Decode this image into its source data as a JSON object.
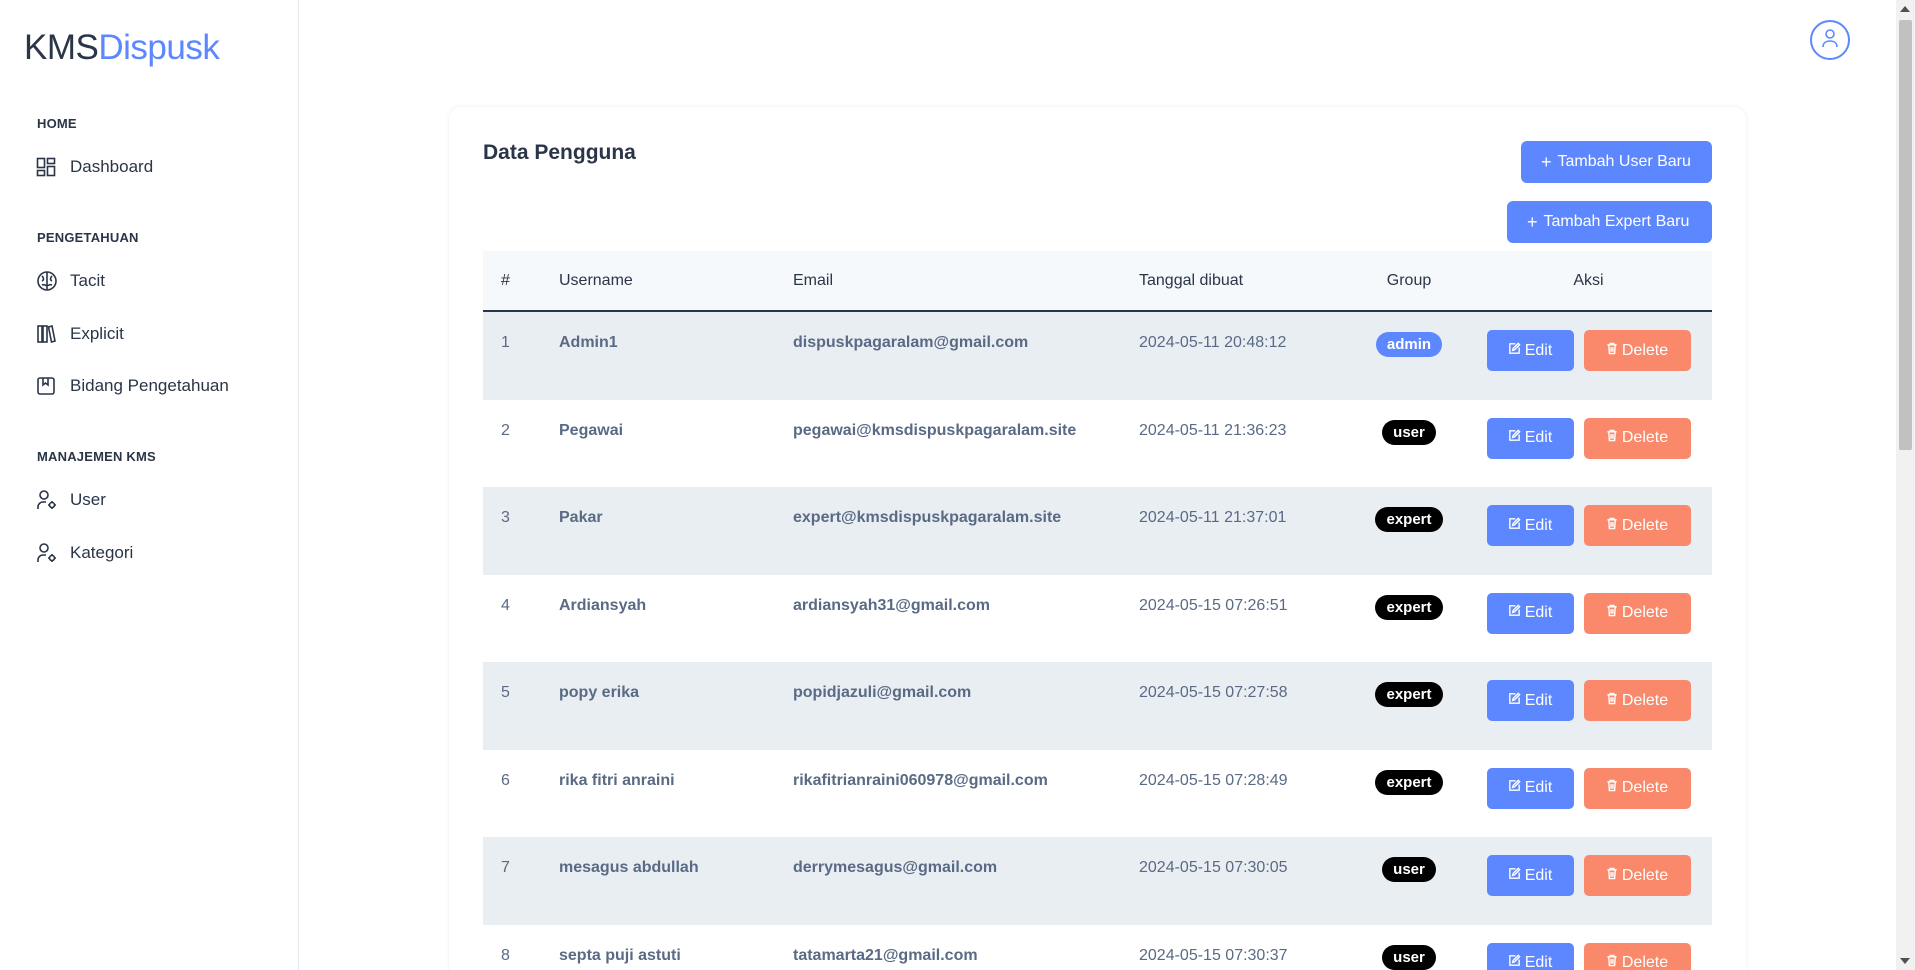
{
  "brand": {
    "part1": "KMS",
    "part2": "Dispusk"
  },
  "sidebar": {
    "sections": [
      {
        "title": "HOME",
        "items": [
          {
            "label": "Dashboard",
            "icon": "dashboard-icon"
          }
        ]
      },
      {
        "title": "PENGETAHUAN",
        "items": [
          {
            "label": "Tacit",
            "icon": "brain-icon"
          },
          {
            "label": "Explicit",
            "icon": "books-icon"
          },
          {
            "label": "Bidang Pengetahuan",
            "icon": "bookmark-icon"
          }
        ]
      },
      {
        "title": "MANAJEMEN KMS",
        "items": [
          {
            "label": "User",
            "icon": "user-cog-icon"
          },
          {
            "label": "Kategori",
            "icon": "user-cog-icon"
          }
        ]
      }
    ]
  },
  "header": {
    "profile_icon": "user-icon"
  },
  "card": {
    "title": "Data Pengguna",
    "add_user_label": "Tambah User Baru",
    "add_expert_label": "Tambah Expert Baru"
  },
  "table": {
    "headers": {
      "num": "#",
      "username": "Username",
      "email": "Email",
      "date": "Tanggal dibuat",
      "group": "Group",
      "aksi": "Aksi"
    },
    "edit_label": "Edit",
    "delete_label": "Delete",
    "rows": [
      {
        "num": "1",
        "username": "Admin1",
        "email": "dispuskpagaralam@gmail.com",
        "date": "2024-05-11 20:48:12",
        "group": "admin"
      },
      {
        "num": "2",
        "username": "Pegawai",
        "email": "pegawai@kmsdispuskpagaralam.site",
        "date": "2024-05-11 21:36:23",
        "group": "user"
      },
      {
        "num": "3",
        "username": "Pakar",
        "email": "expert@kmsdispuskpagaralam.site",
        "date": "2024-05-11 21:37:01",
        "group": "expert"
      },
      {
        "num": "4",
        "username": "Ardiansyah",
        "email": "ardiansyah31@gmail.com",
        "date": "2024-05-15 07:26:51",
        "group": "expert"
      },
      {
        "num": "5",
        "username": "popy erika",
        "email": "popidjazuli@gmail.com",
        "date": "2024-05-15 07:27:58",
        "group": "expert"
      },
      {
        "num": "6",
        "username": "rika fitri anraini",
        "email": "rikafitrianraini060978@gmail.com",
        "date": "2024-05-15 07:28:49",
        "group": "expert"
      },
      {
        "num": "7",
        "username": "mesagus abdullah",
        "email": "derrymesagus@gmail.com",
        "date": "2024-05-15 07:30:05",
        "group": "user"
      },
      {
        "num": "8",
        "username": "septa puji astuti",
        "email": "tatamarta21@gmail.com",
        "date": "2024-05-15 07:30:37",
        "group": "user"
      }
    ]
  },
  "colors": {
    "primary": "#5d87ff",
    "danger": "#fa896b",
    "text": "#2a3547",
    "muted": "#5a6a85"
  }
}
